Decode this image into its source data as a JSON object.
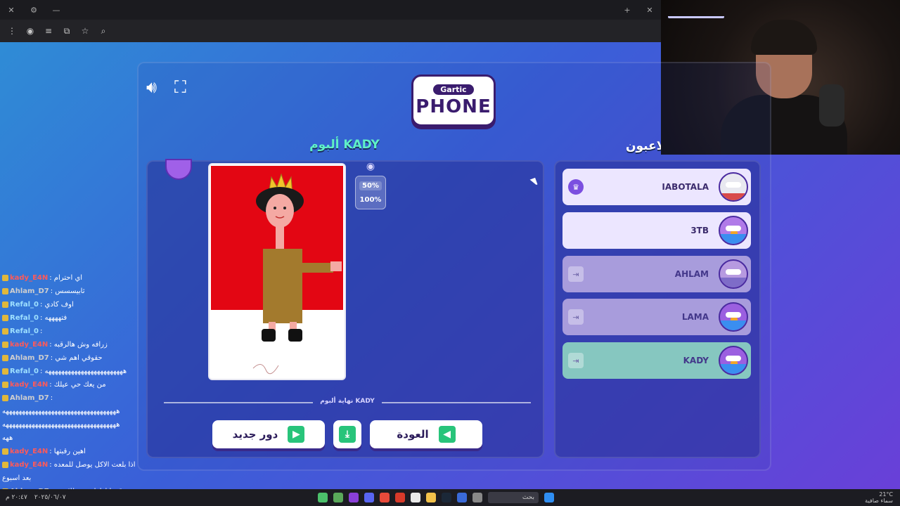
{
  "browser": {
    "titlebar_icons": [
      "close-icon",
      "settings-icon",
      "minimize-icon",
      "new-tab-icon",
      "close-tab-icon"
    ],
    "toolbar_icons": [
      "menu-icon",
      "extension-icon",
      "list-icon",
      "share-icon",
      "star-icon",
      "search-icon"
    ]
  },
  "game": {
    "logo_top": "Gartic",
    "logo_main": "PHONE",
    "album_title": "ألبوم KADY",
    "players_title": "اللاعبون",
    "zoom": {
      "options": [
        "50%",
        "100%"
      ],
      "selected": "50%"
    },
    "album_end_label": "نهاية ألبوم KADY",
    "buttons": {
      "new_round": "دور جديد",
      "back": "العودة"
    },
    "players": [
      {
        "name": "IABOTALA",
        "badge": "crown-icon",
        "state": "host"
      },
      {
        "name": "3TB",
        "badge": "",
        "state": "active"
      },
      {
        "name": "AHLAM",
        "badge": "exit-icon",
        "state": "done"
      },
      {
        "name": "LAMA",
        "badge": "exit-icon",
        "state": "done"
      },
      {
        "name": "KADY",
        "badge": "exit-icon",
        "state": "current"
      }
    ],
    "colors": {
      "accent": "#5ff0c8",
      "button_green": "#28c47a",
      "drawing_bg": "#e30613"
    }
  },
  "chat": [
    {
      "user": "kady_E4N",
      "color": "#ff5a5a",
      "text": ": اي احترام"
    },
    {
      "user": "Ahlam_D7",
      "color": "#cfcfcf",
      "text": ": ثابيسسس"
    },
    {
      "user": "Refal_0",
      "color": "#9ee0ff",
      "text": ": اوف كادي"
    },
    {
      "user": "Refal_0",
      "color": "#9ee0ff",
      "text": ": فتههههه"
    },
    {
      "user": "Refal_0",
      "color": "#9ee0ff",
      "text": ":"
    },
    {
      "user": "kady_E4N",
      "color": "#ff5a5a",
      "text": ": زرافه وش هالرقبه"
    },
    {
      "user": "Ahlam_D7",
      "color": "#cfcfcf",
      "text": ": حقوقي اهم شي"
    },
    {
      "user": "Refal_0",
      "color": "#9ee0ff",
      "text": ": ههههههههههههههههههههههههه"
    },
    {
      "user": "kady_E4N",
      "color": "#ff5a5a",
      "text": ": من يعك حي عيلك"
    },
    {
      "user": "Ahlam_D7",
      "color": "#cfcfcf",
      "text": ":"
    },
    {
      "user": "",
      "color": "#ffffff",
      "text": "هههههههههههههههههههههههههههههههههههه"
    },
    {
      "user": "",
      "color": "#ffffff",
      "text": "هههههههههههههههههههههههههههههههههههه"
    },
    {
      "user": "",
      "color": "#ffffff",
      "text": "ههه"
    },
    {
      "user": "kady_E4N",
      "color": "#ff5a5a",
      "text": ": اهين رقبتها"
    },
    {
      "user": "kady_E4N",
      "color": "#ff5a5a",
      "text": ": اذا بلعت الاكل يوصل للمعده"
    },
    {
      "user": "",
      "color": "#ffffff",
      "text": "بعد اسبوع"
    },
    {
      "user": "Ahlam_D7",
      "color": "#cfcfcf",
      "text": ": رقبتها اطول مني للاسف"
    }
  ],
  "taskbar": {
    "search_label": "بحث",
    "weather": "21°C",
    "weather_desc": "سماء صافية",
    "clock": "٢٠:٤٧ م",
    "date": "٢٠٢٥/٠٦/٠٧"
  }
}
